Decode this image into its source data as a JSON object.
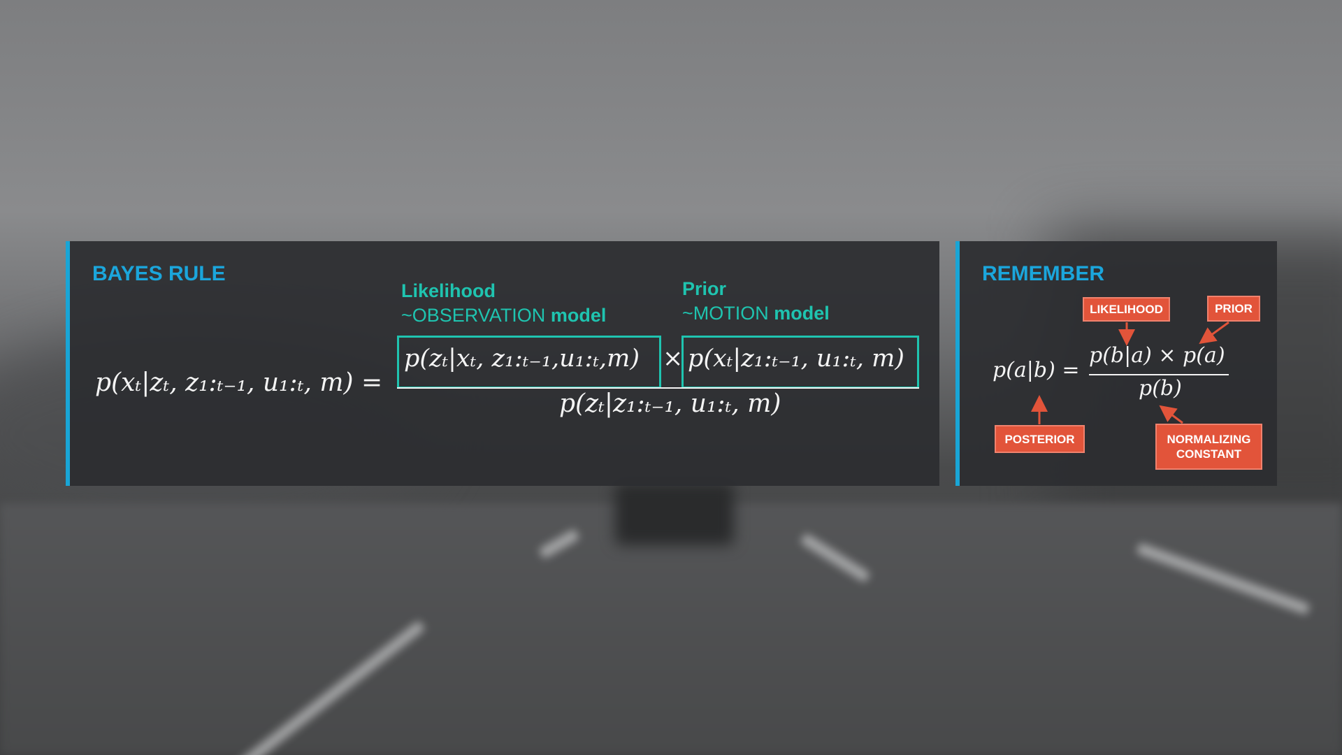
{
  "bayes": {
    "heading": "BAYES RULE",
    "likelihood": {
      "title": "Likelihood",
      "prefix": "~OBSERVATION",
      "suffix": "model"
    },
    "prior": {
      "title": "Prior",
      "prefix": "~MOTION",
      "suffix": "model"
    },
    "formula": {
      "lhs": "p(xₜ|zₜ, z₁:ₜ₋₁, u₁:ₜ, m) =",
      "likelihood_term": "p(zₜ|xₜ, z₁:ₜ₋₁,u₁:ₜ,m)",
      "times": "×",
      "prior_term": "p(xₜ|z₁:ₜ₋₁, u₁:ₜ, m)",
      "denominator": "p(zₜ|z₁:ₜ₋₁, u₁:ₜ, m)"
    }
  },
  "remember": {
    "heading": "REMEMBER",
    "lhs": "p(a|b) =",
    "numerator": "p(b|a) × p(a)",
    "denominator": "p(b)",
    "tags": {
      "likelihood": "LIKELIHOOD",
      "prior": "PRIOR",
      "posterior": "POSTERIOR",
      "normalizing_line1": "NORMALIZING",
      "normalizing_line2": "CONSTANT"
    },
    "tag_color": "#e2543a"
  },
  "colors": {
    "accent_blue": "#1ba6dc",
    "teal": "#1fc4b0"
  }
}
